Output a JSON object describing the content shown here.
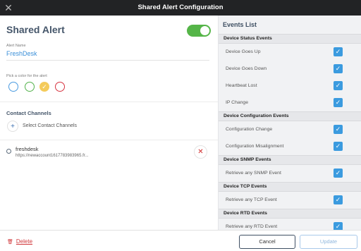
{
  "window": {
    "title": "Shared Alert Configuration",
    "close_icon": "close-icon"
  },
  "alert": {
    "title": "Shared Alert",
    "enabled": true,
    "name_label": "Alert Name",
    "name_value": "FreshDesk",
    "color_label": "Pick a color for the alert",
    "colors": [
      {
        "color": "#4a9be0",
        "selected": false
      },
      {
        "color": "#52b24a",
        "selected": false
      },
      {
        "color": "#f3c23f",
        "selected": true
      },
      {
        "color": "#d6323f",
        "selected": false
      }
    ]
  },
  "contacts": {
    "heading": "Contact Channels",
    "select_label": "Select Contact Channels",
    "channels": [
      {
        "name": "freshdesk",
        "url": "https://newaccount1617783983965.fr..."
      }
    ]
  },
  "events": {
    "heading": "Events List",
    "groups": [
      {
        "name": "Device Status Events",
        "items": [
          {
            "label": "Device Goes Up",
            "checked": true
          },
          {
            "label": "Device Goes Down",
            "checked": true
          },
          {
            "label": "Heartbeat Lost",
            "checked": true
          },
          {
            "label": "IP Change",
            "checked": true
          }
        ]
      },
      {
        "name": "Device Configuration Events",
        "items": [
          {
            "label": "Configuration Change",
            "checked": true
          },
          {
            "label": "Configuration Misalignment",
            "checked": true
          }
        ]
      },
      {
        "name": "Device SNMP Events",
        "items": [
          {
            "label": "Retrieve any SNMP Event",
            "checked": true
          }
        ]
      },
      {
        "name": "Device TCP Events",
        "items": [
          {
            "label": "Retrieve any TCP Event",
            "checked": true
          }
        ]
      },
      {
        "name": "Device RTD Events",
        "items": [
          {
            "label": "Retrieve any RTD Event",
            "checked": true
          }
        ]
      }
    ]
  },
  "footer": {
    "delete_label": "Delete",
    "cancel_label": "Cancel",
    "update_label": "Update"
  }
}
